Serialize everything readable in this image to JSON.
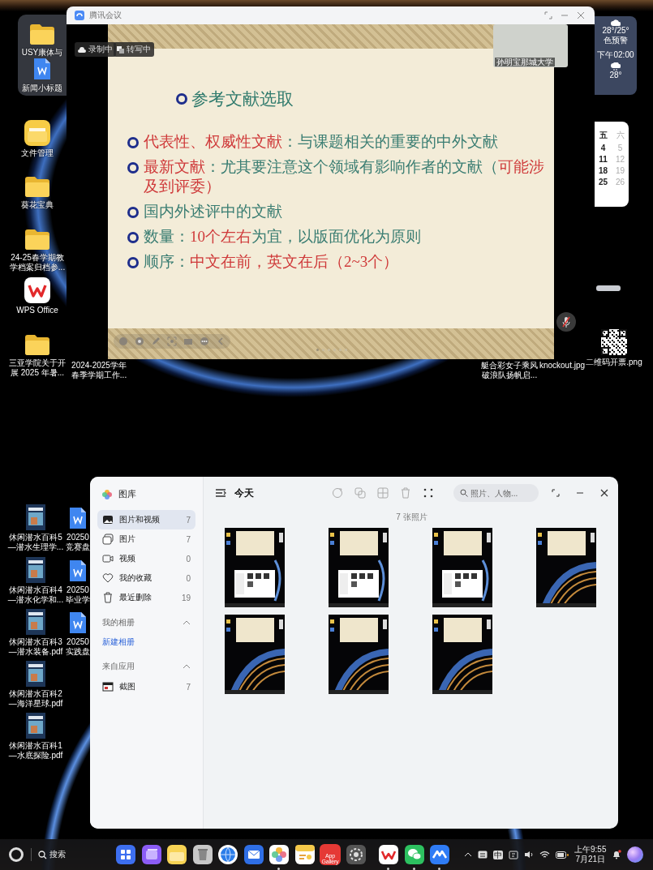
{
  "desktop": {
    "icon_groups": [
      {
        "items": [
          {
            "kind": "folder",
            "lines": [
              "USY康体与"
            ]
          },
          {
            "kind": "doc",
            "lines": [
              "新闻小标题"
            ]
          }
        ]
      },
      {
        "items": [
          {
            "kind": "files_app",
            "lines": [
              "文件管理"
            ]
          },
          {
            "kind": "folder",
            "lines": [
              "葵花宝典"
            ]
          },
          {
            "kind": "folder",
            "lines": [
              "24-25春学期教",
              "学档案归档参..."
            ]
          },
          {
            "kind": "wps",
            "lines": [
              "WPS Office"
            ]
          },
          {
            "kind": "folder",
            "lines": [
              "三亚学院关于开",
              "展 2025 年暑..."
            ]
          }
        ]
      },
      {
        "items": [
          {
            "kind": "none",
            "lines": [
              "2024-2025学年",
              "春季学期工作..."
            ]
          }
        ]
      },
      {
        "items": [
          {
            "kind": "none",
            "lines": [
              "艇合彩女子乘风",
              "破浪队扬帆启..."
            ]
          },
          {
            "kind": "none",
            "lines": [
              "knockout.jpg"
            ]
          },
          {
            "kind": "qr",
            "lines": [
              "二维码开票.png"
            ]
          }
        ]
      },
      {
        "items": [
          {
            "kind": "pdf",
            "lines": [
              "休闲潜水百科5",
              "—潜水生理学..."
            ]
          },
          {
            "kind": "pdf",
            "lines": [
              "休闲潜水百科4",
              "—潜水化学和..."
            ]
          },
          {
            "kind": "pdf",
            "lines": [
              "休闲潜水百科3",
              "—潜水装备.pdf"
            ]
          },
          {
            "kind": "pdf",
            "lines": [
              "休闲潜水百科2",
              "—海洋星球.pdf"
            ]
          },
          {
            "kind": "pdf",
            "lines": [
              "休闲潜水百科1",
              "—水底探险.pdf"
            ]
          }
        ]
      },
      {
        "items": [
          {
            "kind": "doc",
            "lines": [
              "20250",
              "竞赛盘"
            ]
          },
          {
            "kind": "doc",
            "lines": [
              "20250",
              "毕业学"
            ]
          },
          {
            "kind": "doc",
            "lines": [
              "20250",
              "实践盘"
            ]
          }
        ]
      }
    ]
  },
  "weather_widget": {
    "temperature_range": "28°/25°",
    "alert": "色预警",
    "time": "下午02:00",
    "temperature": "28°"
  },
  "calendar_widget": {
    "rows": [
      [
        "五",
        "六"
      ],
      [
        "4",
        "5"
      ],
      [
        "11",
        "12"
      ],
      [
        "18",
        "19"
      ],
      [
        "25",
        "26"
      ]
    ]
  },
  "meeting_window": {
    "title": "腾讯会议",
    "badges": [
      {
        "kind": "recording",
        "label": "录制中"
      },
      {
        "kind": "transcribing",
        "label": "转写中"
      }
    ],
    "participant": {
      "name": "孙明宝那城大学"
    },
    "mic_muted": true,
    "slide": {
      "title": "参考文献选取",
      "bullets": [
        {
          "segments": [
            {
              "text": "代表性、权威性文献",
              "highlight": true
            },
            {
              "text": "：与课题相关的重要的中外文献",
              "highlight": false
            }
          ]
        },
        {
          "segments": [
            {
              "text": "最新文献",
              "highlight": true
            },
            {
              "text": "：尤其要注意这个领域有影响作者的文献（",
              "highlight": false
            },
            {
              "text": "可能涉及到评委）",
              "highlight": true
            }
          ]
        },
        {
          "segments": [
            {
              "text": "国内外述评中的文献",
              "highlight": false
            }
          ]
        },
        {
          "segments": [
            {
              "text": "数量：",
              "highlight": false
            },
            {
              "text": "10个左右",
              "highlight": true
            },
            {
              "text": "为宜，以版面优化为原则",
              "highlight": false
            }
          ]
        },
        {
          "segments": [
            {
              "text": "顺序：",
              "highlight": false
            },
            {
              "text": "中文在前，英文在后（2~3个）",
              "highlight": true
            }
          ]
        }
      ]
    }
  },
  "gallery": {
    "app_name": "图库",
    "sidebar": {
      "items": [
        {
          "kind": "photos_videos",
          "label": "图片和视频",
          "count": "7",
          "selected": true
        },
        {
          "kind": "photos",
          "label": "图片",
          "count": "7",
          "selected": false
        },
        {
          "kind": "videos",
          "label": "视频",
          "count": "0",
          "selected": false
        },
        {
          "kind": "favorites",
          "label": "我的收藏",
          "count": "0",
          "selected": false
        },
        {
          "kind": "deleted",
          "label": "最近删除",
          "count": "19",
          "selected": false
        }
      ],
      "sections": [
        {
          "title": "我的相册",
          "expanded": true,
          "items": [
            {
              "kind": "link",
              "label": "新建相册"
            }
          ]
        },
        {
          "title": "来自应用",
          "expanded": true,
          "items": [
            {
              "kind": "screenshot",
              "label": "截图",
              "count": "7"
            }
          ]
        }
      ]
    },
    "header": {
      "title": "今天",
      "search": {
        "placeholder": "照片、人物..."
      }
    },
    "photo_count": "7 张照片",
    "photos": [
      {
        "kind": "gallery"
      },
      {
        "kind": "gallery"
      },
      {
        "kind": "gallery"
      },
      {
        "kind": "planet"
      },
      {
        "kind": "planet"
      },
      {
        "kind": "planet"
      },
      {
        "kind": "planet"
      }
    ]
  },
  "taskbar": {
    "search_label": "搜索",
    "apps": [
      {
        "kind": "grid",
        "running": false
      },
      {
        "kind": "windows",
        "running": false
      },
      {
        "kind": "folder",
        "running": false
      },
      {
        "kind": "trash",
        "running": false
      },
      {
        "kind": "browser",
        "running": false
      },
      {
        "kind": "mail",
        "running": false
      },
      {
        "kind": "photos",
        "running": true
      },
      {
        "kind": "notes",
        "running": false
      },
      {
        "kind": "store",
        "label": "App Gallery",
        "running": false
      },
      {
        "kind": "settings",
        "running": false
      },
      {
        "kind": "wps",
        "running": true
      },
      {
        "kind": "wechat",
        "running": true
      },
      {
        "kind": "meeting",
        "running": true
      }
    ],
    "tray": {
      "input_method": "中",
      "time": "上午9:55",
      "date": "7月21日"
    }
  }
}
